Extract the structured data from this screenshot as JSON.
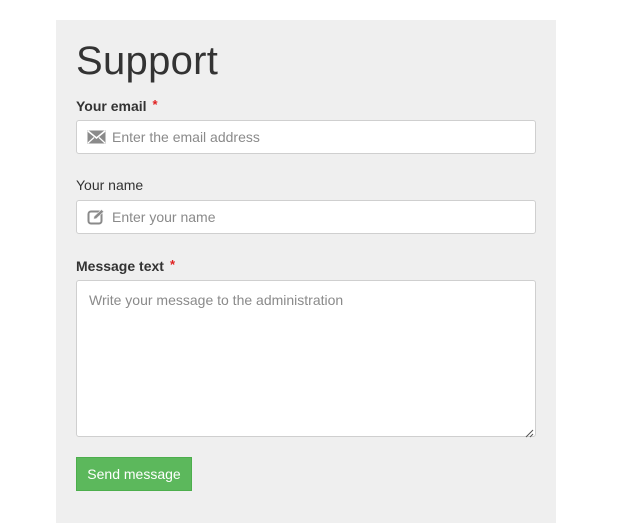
{
  "form": {
    "title": "Support",
    "email": {
      "label": "Your email",
      "required_mark": "*",
      "placeholder": "Enter the email address",
      "icon": "envelope-icon"
    },
    "name": {
      "label": "Your name",
      "placeholder": "Enter your name",
      "icon": "edit-icon"
    },
    "message": {
      "label": "Message text",
      "required_mark": "*",
      "placeholder": "Write your message to the administration"
    },
    "submit_label": "Send message"
  },
  "colors": {
    "panel_background": "#efefef",
    "required_mark": "#e02020",
    "button_background": "#5cb85c",
    "icon": "#888888"
  }
}
